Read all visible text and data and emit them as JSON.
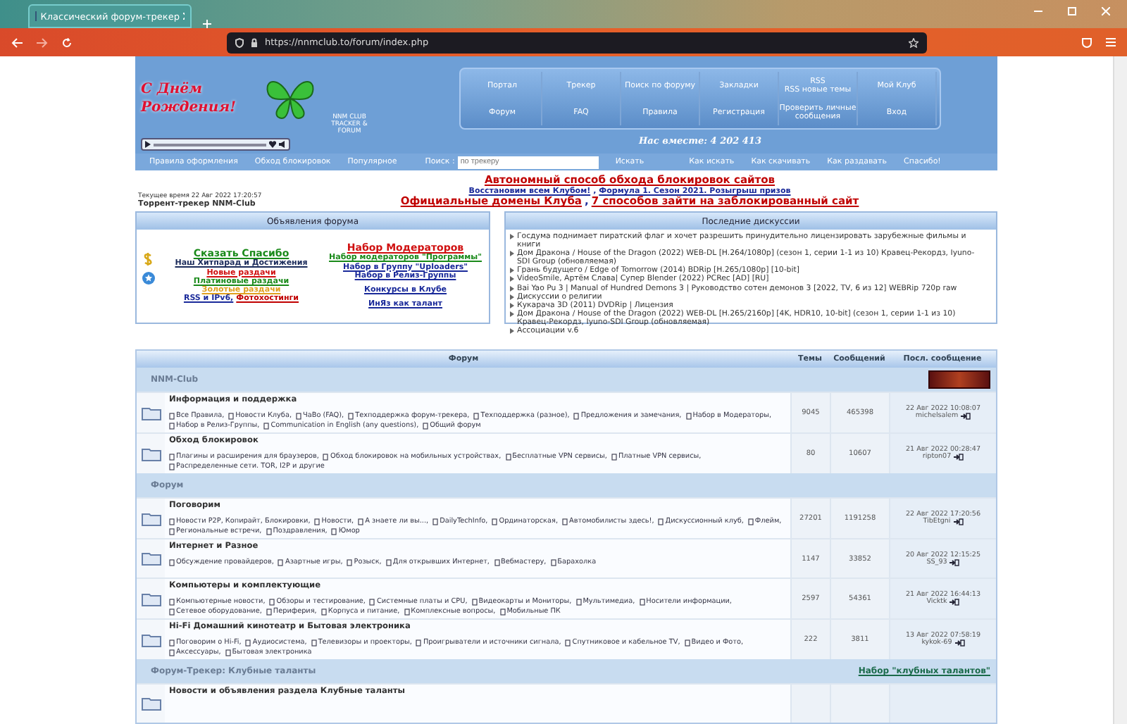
{
  "browser": {
    "tab_title": "Классический форум-трекер",
    "url": "https://nnmclub.to/forum/index.php"
  },
  "header": {
    "logo_title": "С Днём Рождения!",
    "logo_caption": "NNM CLUB TRACKER & FORUM",
    "nav": [
      [
        "Портал",
        "Трекер",
        "Поиск по форуму",
        "Закладки",
        "RSS\nRSS новые темы",
        "Мой Клуб"
      ],
      [
        "Форум",
        "FAQ",
        "Правила",
        "Регистрация",
        "Проверить личные\nсообщения",
        "Вход"
      ]
    ],
    "online": "Нас вместе: 4 202 413"
  },
  "menu": {
    "left": [
      "Правила оформления",
      "Обход блокировок",
      "Популярное"
    ],
    "search_label": "Поиск :",
    "search_placeholder": "по трекеру",
    "search_button": "Искать",
    "right": [
      "Как искать",
      "Как скачивать",
      "Как раздавать",
      "Спасибо!"
    ]
  },
  "info": {
    "time": "Текущее время 22 Авг 2022 17:20:57",
    "site": "Торрент-трекер NNM-Club"
  },
  "notices": [
    {
      "links": [
        {
          "text": "Автономный способ обхода блокировок сайтов",
          "color": "#c00000"
        }
      ]
    },
    {
      "separator": ",",
      "links": [
        {
          "text": "Восстановим всем Клубом!",
          "color": "#1a2a9a"
        },
        {
          "text": "Формула 1. Сезон 2021. Розыгрыш призов",
          "color": "#1a2a9a"
        }
      ]
    },
    {
      "separator": ",",
      "links": [
        {
          "text": "Официальные домены Клуба",
          "color": "#c00000"
        },
        {
          "text": "7 способов зайти на заблокированный сайт",
          "color": "#c00000"
        }
      ]
    }
  ],
  "announcements": {
    "title": "Объявления форума",
    "left": [
      {
        "text": "Сказать Спасибо",
        "color": "#1a8a1a",
        "big": true
      },
      {
        "text": "Наш Хитпарад и Достижения",
        "color": "#1a2a5a"
      },
      {
        "text": "Новые раздачи",
        "color": "#d01010"
      },
      {
        "text": "Платиновые раздачи",
        "color": "#1a8a1a"
      },
      {
        "text": "Золотые раздачи",
        "color": "#e0a020"
      }
    ],
    "left_last": [
      {
        "text": "RSS и IPv6,",
        "color": "#1a2a9a"
      },
      {
        "text": "Фотохостинги",
        "color": "#c00000"
      }
    ],
    "right": [
      {
        "text": "Набор Модераторов",
        "color": "#d01010",
        "big": true
      },
      {
        "text": "Набор модераторов \"Программы\"",
        "color": "#1a8a1a"
      },
      {
        "text": "Набор в Группу \"Uploaders\"",
        "color": "#1a2a9a"
      },
      {
        "text": "Набор в Релиз-Группы",
        "color": "#1a2a9a"
      },
      {
        "text": "Конкурсы в Клубе",
        "color": "#1a2a9a",
        "gap": true
      },
      {
        "text": "ИнЯз как талант",
        "color": "#1a2a9a",
        "gap": true
      }
    ]
  },
  "discussions": {
    "title": "Последние дискуссии",
    "items": [
      "Госдума поднимает пиратский флаг и хочет разрешить принудительно лицензировать зарубежные фильмы и книги",
      "Дом Дракона / House of the Dragon (2022) WEB-DL [H.264/1080p] (сезон 1, серии 1-1 из 10) Кравец-Рекордз, Iyuno-SDI Group (обновляемая)",
      "Грань будущего / Edge of Tomorrow (2014) BDRip [H.265/1080p] [10-bit]",
      "VideoSmile, Артём Слава| Супер Blender (2022) PCRec [AD] [RU]",
      "Bai Yao Pu 3 | Manual of Hundred Demons 3 | Руководство сотен демонов 3 [2022, TV, 6 из 12] WEBRip 720p raw",
      "Дискуссии о религии",
      "Кукарача 3D (2011) DVDRip | Лицензия",
      "Дом Дракона / House of the Dragon (2022) WEB-DL [H.265/2160p] [4K, HDR10, 10-bit] (сезон 1, серии 1-1 из 10) Кравец-Рекордз, Iyuno-SDI Group (обновляемая)",
      "Ассоциации v.6"
    ]
  },
  "forum": {
    "columns": [
      "Форум",
      "Темы",
      "Сообщений",
      "Посл. сообщение"
    ],
    "categories": [
      {
        "title": "NNM-Club",
        "banner": true,
        "forums": [
          {
            "title": "Информация и поддержка",
            "subforums": [
              "Все Правила,",
              "Новости Клуба,",
              "ЧаВо (FAQ),",
              "Техподдержка форум-трекера,",
              "Техподдержка (разное),",
              "Предложения и замечания,",
              "Набор в Модераторы,",
              "Набор в Релиз-Группы,",
              "Communication in English (any questions),",
              "Общий форум"
            ],
            "topics": "9045",
            "posts": "465398",
            "last_date": "22 Авг 2022 10:08:07",
            "last_user": "michelsalem"
          },
          {
            "title": "Обход блокировок",
            "subforums": [
              "Плагины и расширения для браузеров,",
              "Обход блокировок на мобильных устройствах,",
              "Бесплатные VPN сервисы,",
              "Платные VPN сервисы,",
              "Распределенные сети. TOR, I2P и другие"
            ],
            "topics": "80",
            "posts": "10607",
            "last_date": "21 Авг 2022 00:28:47",
            "last_user": "ripton07"
          }
        ]
      },
      {
        "title": "Форум",
        "forums": [
          {
            "title": "Поговорим",
            "subforums": [
              "Новости P2P, Копирайт, Блокировки,",
              "Новости,",
              "А знаете ли вы...,",
              "DailyTechInfo,",
              "Ординаторская,",
              "Автомобилисты здесь!,",
              "Дискуссионный клуб,",
              "Флейм,",
              "Региональные встречи,",
              "Поздравления,",
              "Юмор"
            ],
            "topics": "27201",
            "posts": "1191258",
            "last_date": "22 Авг 2022 17:20:56",
            "last_user": "TibEtgni"
          },
          {
            "title": "Интернет и Разное",
            "subforums": [
              "Обсуждение провайдеров,",
              "Азартные игры,",
              "Розыск,",
              "Для открывших Интернет,",
              "Вебмастеру,",
              "Барахолка"
            ],
            "topics": "1147",
            "posts": "33852",
            "last_date": "20 Авг 2022 12:15:25",
            "last_user": "SS_93"
          },
          {
            "title": "Компьютеры и комплектующие",
            "subforums": [
              "Компьютерные новости,",
              "Обзоры и тестирование,",
              "Системные платы и CPU,",
              "Видеокарты и Мониторы,",
              "Мультимедиа,",
              "Носители информации,",
              "Сетевое оборудование,",
              "Периферия,",
              "Корпуса и питание,",
              "Комплексные вопросы,",
              "Мобильные ПК"
            ],
            "topics": "2597",
            "posts": "54361",
            "last_date": "21 Авг 2022 16:44:13",
            "last_user": "Vicktk"
          },
          {
            "title": "Hi-Fi Домашний кинотеатр и Бытовая электроника",
            "subforums": [
              "Поговорим о Hi-Fi,",
              "Аудиосистема,",
              "Телевизоры и проекторы,",
              "Проигрыватели и источники сигнала,",
              "Спутниковое и кабельное TV,",
              "Видео и Фото,",
              "Аксессуары,",
              "Бытовая электроника"
            ],
            "topics": "222",
            "posts": "3811",
            "last_date": "13 Авг 2022 07:58:19",
            "last_user": "kykok-69"
          }
        ]
      },
      {
        "title": "Форум-Трекер: Клубные таланты",
        "link": "Набор \"клубных талантов\"",
        "forums": [
          {
            "title": "Новости и объявления раздела Клубные таланты"
          }
        ]
      }
    ]
  }
}
